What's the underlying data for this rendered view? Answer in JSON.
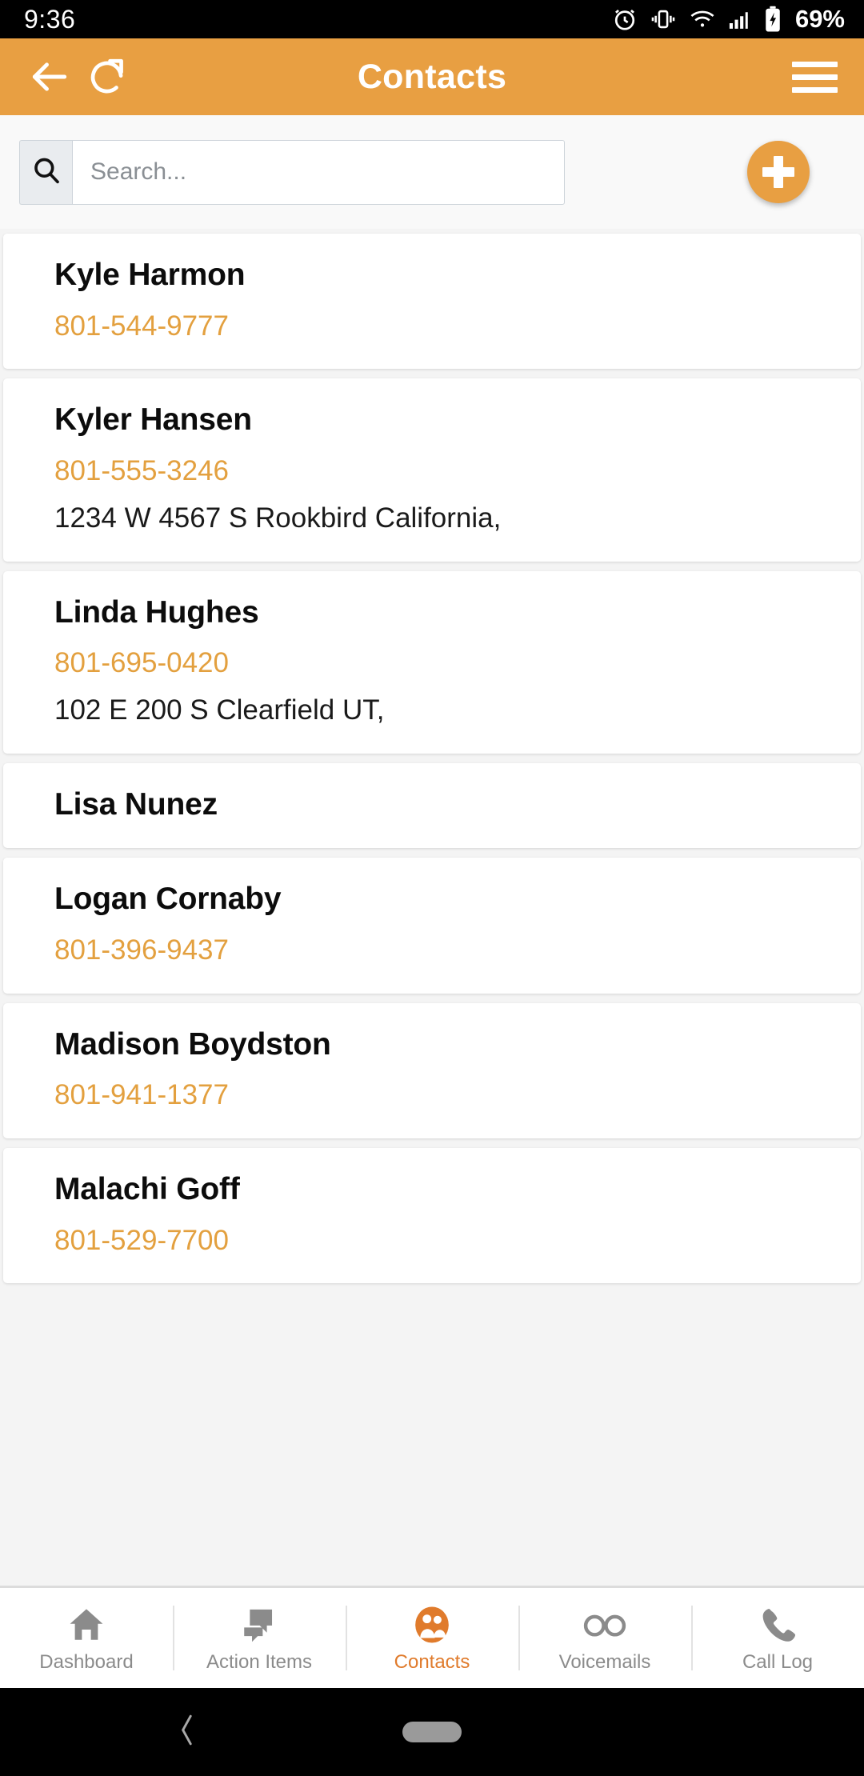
{
  "status_bar": {
    "clock": "9:36",
    "battery_percent": "69%",
    "icons": [
      "alarm-icon",
      "vibrate-icon",
      "wifi-icon",
      "cellular-signal-icon",
      "battery-charging-icon"
    ]
  },
  "header": {
    "title": "Contacts",
    "back_icon": "back-arrow-icon",
    "refresh_icon": "refresh-icon",
    "menu_icon": "hamburger-menu-icon",
    "background_color": "#e89f42"
  },
  "search": {
    "placeholder": "Search...",
    "value": "",
    "icon": "search-icon",
    "add_button_icon": "plus-icon",
    "add_button_color": "#e89f42"
  },
  "contacts": [
    {
      "name": "Kyle Harmon",
      "phone": "801-544-9777",
      "address": ""
    },
    {
      "name": "Kyler Hansen",
      "phone": "801-555-3246",
      "address": "1234 W 4567 S Rookbird California,"
    },
    {
      "name": "Linda Hughes",
      "phone": "801-695-0420",
      "address": "102 E 200 S Clearfield UT,"
    },
    {
      "name": "Lisa Nunez",
      "phone": "",
      "address": ""
    },
    {
      "name": "Logan Cornaby",
      "phone": "801-396-9437",
      "address": ""
    },
    {
      "name": "Madison Boydston",
      "phone": "801-941-1377",
      "address": ""
    },
    {
      "name": "Malachi Goff",
      "phone": "801-529-7700",
      "address": ""
    }
  ],
  "tabbar": {
    "active_color": "#e07b2c",
    "inactive_color": "#8b8b8b",
    "items": [
      {
        "label": "Dashboard",
        "icon": "home-icon",
        "active": false
      },
      {
        "label": "Action Items",
        "icon": "chat-icon",
        "active": false
      },
      {
        "label": "Contacts",
        "icon": "people-icon",
        "active": true
      },
      {
        "label": "Voicemails",
        "icon": "voicemail-icon",
        "active": false
      },
      {
        "label": "Call Log",
        "icon": "phone-icon",
        "active": false
      }
    ]
  },
  "system_nav": {
    "back_icon": "chevron-left-icon",
    "home_icon": "home-pill-icon"
  }
}
